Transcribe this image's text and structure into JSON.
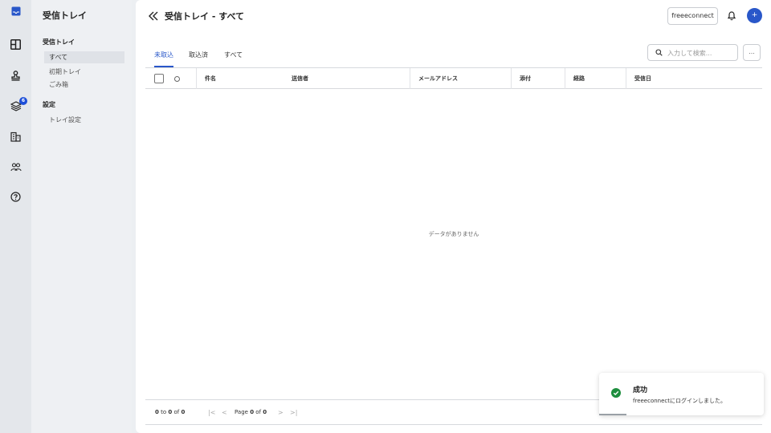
{
  "rail": {
    "items": [
      {
        "icon": "inbox-icon",
        "active": true
      },
      {
        "icon": "grid-icon"
      },
      {
        "icon": "stamp-icon"
      },
      {
        "icon": "layers-icon",
        "badge": "6"
      },
      {
        "icon": "building-icon"
      },
      {
        "icon": "users-icon"
      },
      {
        "icon": "help-icon"
      }
    ]
  },
  "sidenav": {
    "title": "受信トレイ",
    "groups": [
      {
        "label": "受信トレイ",
        "items": [
          "すべて",
          "初期トレイ",
          "ごみ箱"
        ]
      },
      {
        "label": "設定",
        "items": [
          "トレイ設定"
        ]
      }
    ]
  },
  "header": {
    "title": "受信トレイ - すべて",
    "org_button": "freeeconnect",
    "avatar_initial": "+"
  },
  "tabs": [
    "未取込",
    "取込済",
    "すべて"
  ],
  "search": {
    "placeholder": "入力して検索..."
  },
  "more_button": "...",
  "table": {
    "columns": [
      "件名",
      "送信者",
      "メールアドレス",
      "添付",
      "経路",
      "受信日"
    ],
    "empty_message": "データがありません"
  },
  "pagination": {
    "from": "0",
    "to_word": "to",
    "to": "0",
    "of_word": "of",
    "total": "0",
    "page_word": "Page",
    "page": "0",
    "page_of": "of",
    "page_total": "0"
  },
  "toast": {
    "title": "成功",
    "message": "freeeconnectにログインしました。"
  },
  "colors": {
    "accent": "#2957c9",
    "success": "#1e8e3e",
    "badge": "#1d4ed8"
  }
}
